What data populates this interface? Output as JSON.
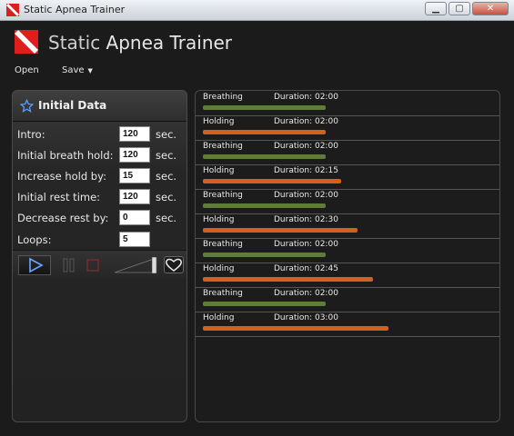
{
  "window": {
    "title": "Static Apnea Trainer",
    "buttons": [
      "minimize",
      "restore",
      "close"
    ]
  },
  "header": {
    "title_light": "Static",
    "title_main": "Apnea Trainer",
    "logo_icon": "dive-flag-icon"
  },
  "menu": {
    "open": "Open",
    "save": "Save"
  },
  "initial_data": {
    "title": "Initial Data",
    "fields": [
      {
        "label": "Intro:",
        "value": "120",
        "unit": "sec."
      },
      {
        "label": "Initial breath hold:",
        "value": "120",
        "unit": "sec."
      },
      {
        "label": "Increase hold by:",
        "value": "15",
        "unit": "sec."
      },
      {
        "label": "Initial rest time:",
        "value": "120",
        "unit": "sec."
      },
      {
        "label": "Decrease rest by:",
        "value": "0",
        "unit": "sec."
      },
      {
        "label": "Loops:",
        "value": "5",
        "unit": ""
      }
    ]
  },
  "controls": {
    "play_icon": "play-icon",
    "pause_icon": "pause-icon",
    "stop_icon": "stop-icon",
    "volume_icon": "volume-slider-icon",
    "heart_icon": "heart-icon",
    "volume_level": 0.9
  },
  "colors": {
    "breathing": "#5e7d3c",
    "holding": "#d2611f"
  },
  "schedule": [
    {
      "name": "Breathing",
      "duration": "Duration: 02:00",
      "seconds": 120,
      "kind": "breathing"
    },
    {
      "name": "Holding",
      "duration": "Duration: 02:00",
      "seconds": 120,
      "kind": "holding"
    },
    {
      "name": "Breathing",
      "duration": "Duration: 02:00",
      "seconds": 120,
      "kind": "breathing"
    },
    {
      "name": "Holding",
      "duration": "Duration: 02:15",
      "seconds": 135,
      "kind": "holding"
    },
    {
      "name": "Breathing",
      "duration": "Duration: 02:00",
      "seconds": 120,
      "kind": "breathing"
    },
    {
      "name": "Holding",
      "duration": "Duration: 02:30",
      "seconds": 150,
      "kind": "holding"
    },
    {
      "name": "Breathing",
      "duration": "Duration: 02:00",
      "seconds": 120,
      "kind": "breathing"
    },
    {
      "name": "Holding",
      "duration": "Duration: 02:45",
      "seconds": 165,
      "kind": "holding"
    },
    {
      "name": "Breathing",
      "duration": "Duration: 02:00",
      "seconds": 120,
      "kind": "breathing"
    },
    {
      "name": "Holding",
      "duration": "Duration: 03:00",
      "seconds": 180,
      "kind": "holding"
    }
  ]
}
